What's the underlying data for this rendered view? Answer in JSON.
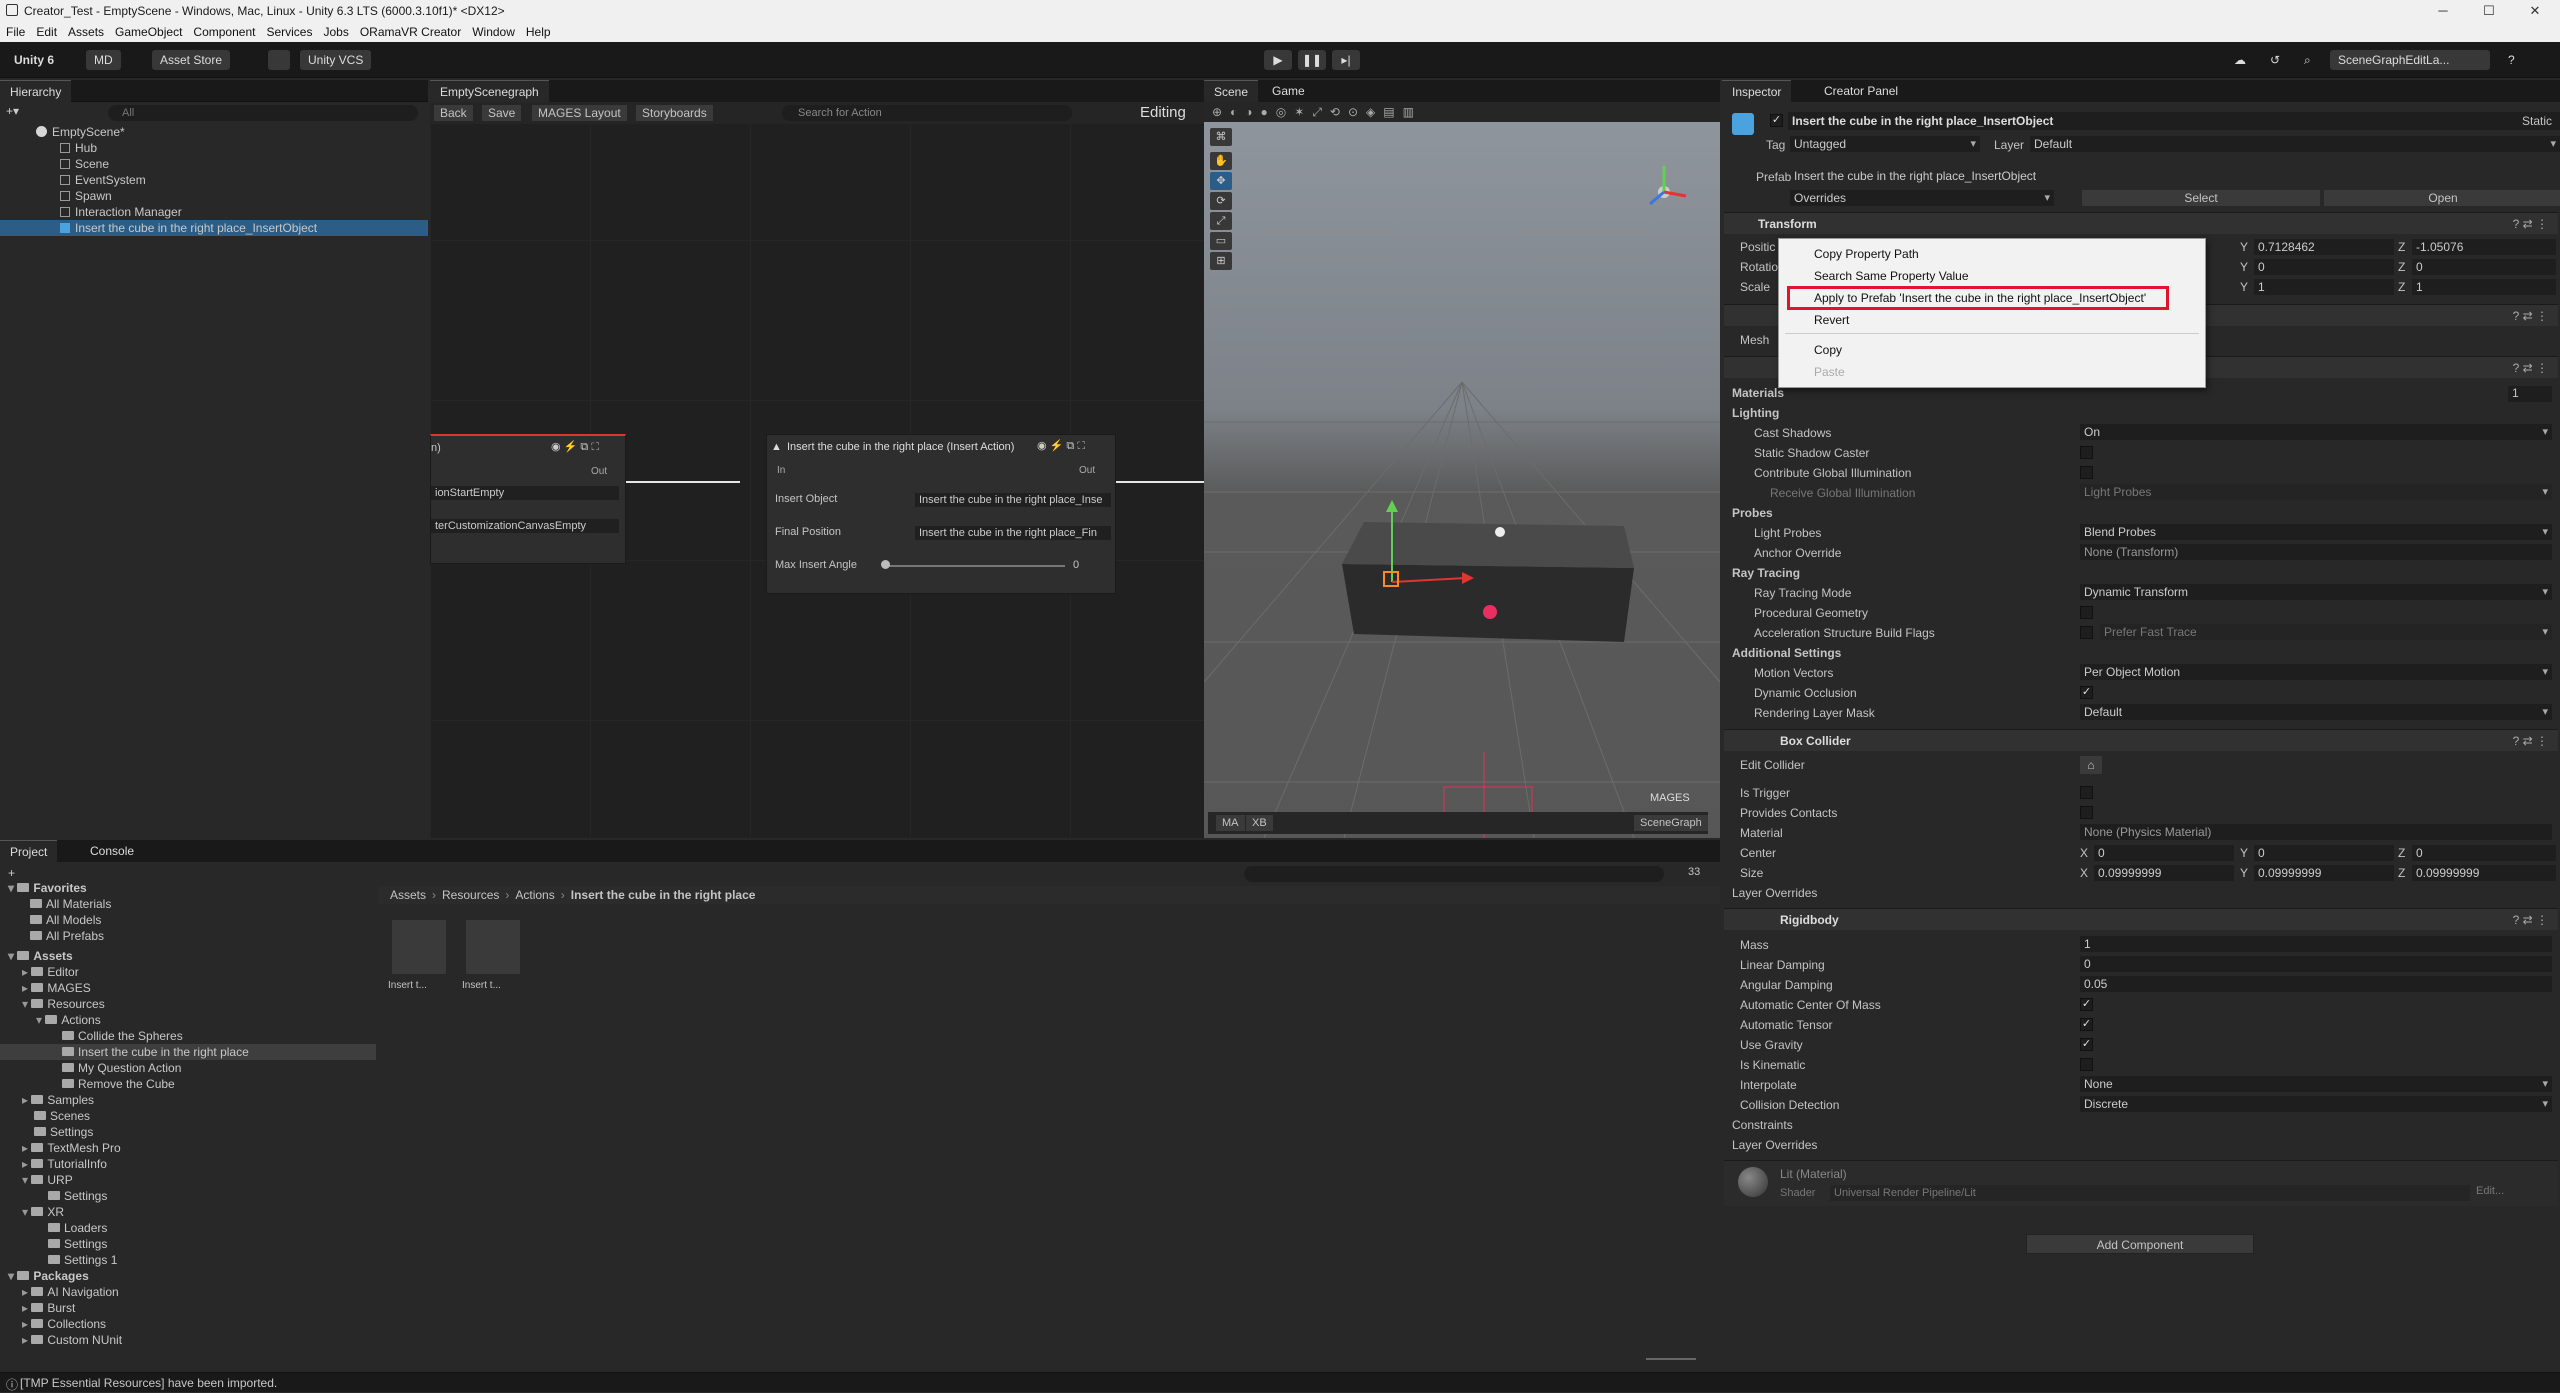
{
  "window": {
    "title": "Creator_Test - EmptyScene - Windows, Mac, Linux - Unity 6.3 LTS (6000.3.10f1)* <DX12>",
    "minimize": "─",
    "maximize": "☐",
    "close": "✕"
  },
  "menu": [
    "File",
    "Edit",
    "Assets",
    "GameObject",
    "Component",
    "Services",
    "Jobs",
    "ORamaVR Creator",
    "Window",
    "Help"
  ],
  "toolbar": {
    "unity_label": "Unity 6",
    "account": "MD",
    "asset_store": "Asset Store",
    "vcs": "Unity VCS",
    "layout": "SceneGraphEditLa..."
  },
  "hierarchy": {
    "tab": "Hierarchy",
    "search_placeholder": "All",
    "scene": "EmptyScene*",
    "items": [
      "Hub",
      "Scene",
      "EventSystem",
      "Spawn",
      "Interaction Manager",
      "Insert the cube in the right place_InsertObject"
    ]
  },
  "graph": {
    "tab": "EmptyScenegraph",
    "back": "Back",
    "save": "Save",
    "mages_layout": "MAGES Layout",
    "storyboards": "Storyboards",
    "search_placeholder": "Search for Action",
    "mode": "Editing",
    "left_node": {
      "title": "n)",
      "out": "Out",
      "field1": "ionStartEmpty",
      "field2": "terCustomizationCanvasEmpty"
    },
    "main_node": {
      "title": "Insert the cube in the right place (Insert Action)",
      "in": "In",
      "out": "Out",
      "insert_object_label": "Insert Object",
      "insert_object_value": "Insert the cube in the right place_Inse",
      "final_position_label": "Final Position",
      "final_position_value": "Insert the cube in the right place_Fin",
      "max_angle_label": "Max Insert Angle",
      "max_angle_value": "0"
    }
  },
  "scene_view": {
    "tab_scene": "Scene",
    "tab_game": "Game",
    "bottom_tools": [
      "MA",
      "XB"
    ],
    "mages_label": "MAGES",
    "scenegraph_btn": "SceneGraph"
  },
  "inspector": {
    "tab": "Inspector",
    "tab2": "Creator Panel",
    "object_name": "Insert the cube in the right place_InsertObject",
    "static": "Static",
    "tag_label": "Tag",
    "tag_value": "Untagged",
    "layer_label": "Layer",
    "layer_value": "Default",
    "prefab_label": "Prefab",
    "prefab_value": "Insert the cube in the right place_InsertObject",
    "overrides": "Overrides",
    "select": "Select",
    "open": "Open",
    "transform": {
      "title": "Transform",
      "position_label": "Positic",
      "rotation_label": "Rotatio",
      "scale_label": "Scale",
      "pos_y": "0.7128462",
      "pos_z": "-1.05076",
      "rot_y": "0",
      "rot_z": "0",
      "scale_y": "1",
      "scale_z": "1"
    },
    "mesh_label": "Mesh",
    "materials": "Materials",
    "materials_count": "1",
    "lighting": "Lighting",
    "cast_shadows_label": "Cast Shadows",
    "cast_shadows_value": "On",
    "static_shadow_caster": "Static Shadow Caster",
    "contribute_gi": "Contribute Global Illumination",
    "receive_gi_label": "Receive Global Illumination",
    "receive_gi_value": "Light Probes",
    "probes": "Probes",
    "light_probes_label": "Light Probes",
    "light_probes_value": "Blend Probes",
    "anchor_override_label": "Anchor Override",
    "anchor_override_value": "None (Transform)",
    "ray_tracing": "Ray Tracing",
    "ray_tracing_mode_label": "Ray Tracing Mode",
    "ray_tracing_mode_value": "Dynamic Transform",
    "procedural_geometry": "Procedural Geometry",
    "accel_flags_label": "Acceleration Structure Build Flags",
    "accel_flags_value": "Prefer Fast Trace",
    "additional_settings": "Additional Settings",
    "motion_vectors_label": "Motion Vectors",
    "motion_vectors_value": "Per Object Motion",
    "dynamic_occlusion": "Dynamic Occlusion",
    "rendering_layer_label": "Rendering Layer Mask",
    "rendering_layer_value": "Default",
    "box_collider": {
      "title": "Box Collider",
      "edit_collider": "Edit Collider",
      "is_trigger": "Is Trigger",
      "provides_contacts": "Provides Contacts",
      "material_label": "Material",
      "material_value": "None (Physics Material)",
      "center_label": "Center",
      "cx": "0",
      "cy": "0",
      "cz": "0",
      "size_label": "Size",
      "sx": "0.09999999",
      "sy": "0.09999999",
      "sz": "0.09999999",
      "layer_overrides": "Layer Overrides"
    },
    "rigidbody": {
      "title": "Rigidbody",
      "mass_label": "Mass",
      "mass": "1",
      "linear_label": "Linear Damping",
      "linear": "0",
      "angular_label": "Angular Damping",
      "angular": "0.05",
      "auto_com": "Automatic Center Of Mass",
      "auto_tensor": "Automatic Tensor",
      "use_gravity": "Use Gravity",
      "is_kinematic": "Is Kinematic",
      "interpolate_label": "Interpolate",
      "interpolate": "None",
      "collision_label": "Collision Detection",
      "collision": "Discrete",
      "constraints": "Constraints",
      "layer_overrides": "Layer Overrides"
    },
    "material": {
      "name": "Lit (Material)",
      "shader_label": "Shader",
      "shader_value": "Universal Render Pipeline/Lit",
      "edit": "Edit..."
    },
    "add_component": "Add Component"
  },
  "context_menu": {
    "copy_path": "Copy Property Path",
    "search_same": "Search Same Property Value",
    "apply_prefab": "Apply to Prefab 'Insert the cube in the right place_InsertObject'",
    "revert": "Revert",
    "copy": "Copy",
    "paste": "Paste"
  },
  "project": {
    "tab": "Project",
    "tab2": "Console",
    "breadcrumb": [
      "Assets",
      "Resources",
      "Actions",
      "Insert the cube in the right place"
    ],
    "count": "33",
    "favorites": "Favorites",
    "fav_items": [
      "All Materials",
      "All Models",
      "All Prefabs"
    ],
    "assets_root": "Assets",
    "tree": [
      {
        "label": "Editor",
        "indent": 1,
        "arrow": "▸"
      },
      {
        "label": "MAGES",
        "indent": 1,
        "arrow": "▸"
      },
      {
        "label": "Resources",
        "indent": 1,
        "arrow": "▾"
      },
      {
        "label": "Actions",
        "indent": 2,
        "arrow": "▾"
      },
      {
        "label": "Collide the Spheres",
        "indent": 3,
        "arrow": ""
      },
      {
        "label": "Insert the cube in the right place",
        "indent": 3,
        "arrow": "",
        "sel": true
      },
      {
        "label": "My Question Action",
        "indent": 3,
        "arrow": ""
      },
      {
        "label": "Remove the Cube",
        "indent": 3,
        "arrow": ""
      },
      {
        "label": "Samples",
        "indent": 1,
        "arrow": "▸"
      },
      {
        "label": "Scenes",
        "indent": 1,
        "arrow": ""
      },
      {
        "label": "Settings",
        "indent": 1,
        "arrow": ""
      },
      {
        "label": "TextMesh Pro",
        "indent": 1,
        "arrow": "▸"
      },
      {
        "label": "TutorialInfo",
        "indent": 1,
        "arrow": "▸"
      },
      {
        "label": "URP",
        "indent": 1,
        "arrow": "▾"
      },
      {
        "label": "Settings",
        "indent": 2,
        "arrow": ""
      },
      {
        "label": "XR",
        "indent": 1,
        "arrow": "▾"
      },
      {
        "label": "Loaders",
        "indent": 2,
        "arrow": ""
      },
      {
        "label": "Settings",
        "indent": 2,
        "arrow": ""
      },
      {
        "label": "Settings 1",
        "indent": 2,
        "arrow": ""
      }
    ],
    "packages_root": "Packages",
    "packages": [
      "AI Navigation",
      "Burst",
      "Collections",
      "Custom NUnit"
    ],
    "files": [
      "Insert t...",
      "Insert t..."
    ]
  },
  "status": {
    "message": "[TMP Essential Resources] have been imported."
  },
  "colors": {
    "selection": "#2c5d87",
    "highlight_box": "#e0142c"
  }
}
